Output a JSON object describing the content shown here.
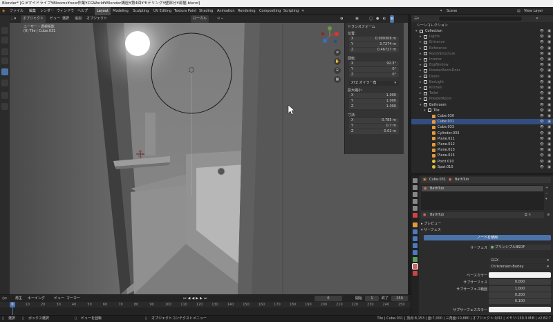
{
  "window_title": "Blender* [G:¥マイドライブ¥Blooms¥new作業¥CGWorld¥Blender講座¥第4回¥モデリング¥壁部分¥部屋.blend]",
  "menu": [
    "ファイル",
    "編集",
    "レンダー",
    "ウィンドウ",
    "ヘルプ"
  ],
  "workspaces": [
    "Layout",
    "Modeling",
    "Sculpting",
    "UV Editing",
    "Texture Paint",
    "Shading",
    "Animation",
    "Rendering",
    "Compositing",
    "Scripting"
  ],
  "active_workspace": "Layout",
  "scene_label": "Scene",
  "view_layer_label": "View Layer",
  "viewport": {
    "header": [
      "オブジェクト",
      "ビュー",
      "選択",
      "追加",
      "オブジェクト"
    ],
    "transform_orientation": "ローカル",
    "view_name": "ユーザー・透視投影",
    "object_info": "(0) Tile | Cube.031"
  },
  "npanel": {
    "section": "トランスフォーム",
    "location_label": "位置:",
    "location": [
      {
        "k": "X",
        "v": "0.099308 m"
      },
      {
        "k": "Y",
        "v": "3.7274 m"
      },
      {
        "k": "Z",
        "v": "0.46727 m"
      }
    ],
    "rotation_label": "回転:",
    "rotation": [
      {
        "k": "X",
        "v": "92.3°"
      },
      {
        "k": "Y",
        "v": "0°"
      },
      {
        "k": "Z",
        "v": "0°"
      }
    ],
    "rotation_mode": "XYZ オイラー角",
    "scale_label": "拡大縮小:",
    "scale": [
      {
        "k": "X",
        "v": "1.000"
      },
      {
        "k": "Y",
        "v": "1.000"
      },
      {
        "k": "Z",
        "v": "1.000"
      }
    ],
    "dimensions_label": "寸法:",
    "dimensions": [
      {
        "k": "X",
        "v": "0.785 m"
      },
      {
        "k": "Y",
        "v": "0.7 m"
      },
      {
        "k": "Z",
        "v": "0.02 m"
      }
    ]
  },
  "outliner": {
    "header": "シーンコレクション",
    "rows": [
      {
        "label": "Collection",
        "indent": 1,
        "type": "collection"
      },
      {
        "label": "Lights",
        "indent": 2,
        "type": "collection",
        "dim": true
      },
      {
        "label": "Entrance",
        "indent": 2,
        "type": "collection",
        "dim": true
      },
      {
        "label": "Reference",
        "indent": 2,
        "type": "collection",
        "dim": true
      },
      {
        "label": "RoomStructure",
        "indent": 2,
        "type": "collection",
        "dim": true
      },
      {
        "label": "Interior",
        "indent": 2,
        "type": "collection",
        "dim": true
      },
      {
        "label": "BigWindow",
        "indent": 2,
        "type": "collection",
        "dim": true
      },
      {
        "label": "PowderRoomDoor",
        "indent": 2,
        "type": "collection",
        "dim": true
      },
      {
        "label": "Doors",
        "indent": 2,
        "type": "collection",
        "dim": true
      },
      {
        "label": "BarLight",
        "indent": 2,
        "type": "collection",
        "dim": true
      },
      {
        "label": "Kitchen",
        "indent": 2,
        "type": "collection",
        "dim": true
      },
      {
        "label": "Toilet",
        "indent": 2,
        "type": "collection",
        "dim": true
      },
      {
        "label": "PowderRoom",
        "indent": 2,
        "type": "collection",
        "dim": true
      },
      {
        "label": "Bathroom",
        "indent": 2,
        "type": "collection"
      },
      {
        "label": "Tile",
        "indent": 3,
        "type": "collection"
      },
      {
        "label": "Cube.030",
        "indent": 4,
        "type": "mesh"
      },
      {
        "label": "Cube.031",
        "indent": 4,
        "type": "mesh"
      },
      {
        "label": "Cube.033",
        "indent": 4,
        "type": "mesh"
      },
      {
        "label": "Cylinder.033",
        "indent": 4,
        "type": "mesh"
      },
      {
        "label": "Plane.011",
        "indent": 4,
        "type": "mesh"
      },
      {
        "label": "Plane.012",
        "indent": 4,
        "type": "mesh"
      },
      {
        "label": "Plane.013",
        "indent": 4,
        "type": "mesh"
      },
      {
        "label": "Plane.015",
        "indent": 4,
        "type": "mesh"
      },
      {
        "label": "Point.010",
        "indent": 4,
        "type": "light"
      },
      {
        "label": "Spot.010",
        "indent": 4,
        "type": "light"
      }
    ]
  },
  "properties": {
    "object_name": "Cube.031",
    "material_name": "BathTub",
    "slot_name": "BathTub",
    "preview_label": "プレビュー",
    "surface_section": "サーフェス",
    "use_nodes_button": "ノードを使用",
    "surface_label": "サーフェス",
    "surface_value": "プリンシプルBSDF",
    "distribution": "GGX",
    "subsurface_method": "Christensen-Burley",
    "base_color_label": "ベースカラー",
    "subsurface_label": "サブサーフェス",
    "subsurface_value": "0.000",
    "subsurface_radius_label": "サブサーフェス範囲",
    "subsurface_radius": [
      "1.000",
      "0.200",
      "0.100"
    ],
    "subsurface_color_label": "サブサーフェスカラー"
  },
  "timeline": {
    "menu": [
      "再生",
      "キーイング",
      "ビュー",
      "マーカー"
    ],
    "current_frame": "0",
    "start_label": "開始",
    "start": "1",
    "end_label": "終了",
    "end": "250",
    "ticks": [
      "0",
      "10",
      "20",
      "30",
      "40",
      "50",
      "60",
      "70",
      "80",
      "90",
      "100",
      "110",
      "120",
      "130",
      "140",
      "150",
      "160",
      "170",
      "180",
      "190",
      "200",
      "210",
      "220",
      "230",
      "240",
      "250"
    ]
  },
  "status": {
    "select": "選択",
    "box_select": "ボックス選択",
    "rotate_view": "ビューを回転",
    "context_menu": "オブジェクトコンテクストメニュー",
    "stats": "Tile | Cube.031 | 頂点:8,153 | 面:7,000 | 三角面:10,880 | オブジェクト:0/32 | メモリ:130.3 MiB | v2.82.7"
  },
  "colors": {
    "accent": "#4b73a8",
    "selected_row": "#334d80",
    "mesh_icon": "#e39a3b",
    "light_icon": "#e0c040"
  }
}
